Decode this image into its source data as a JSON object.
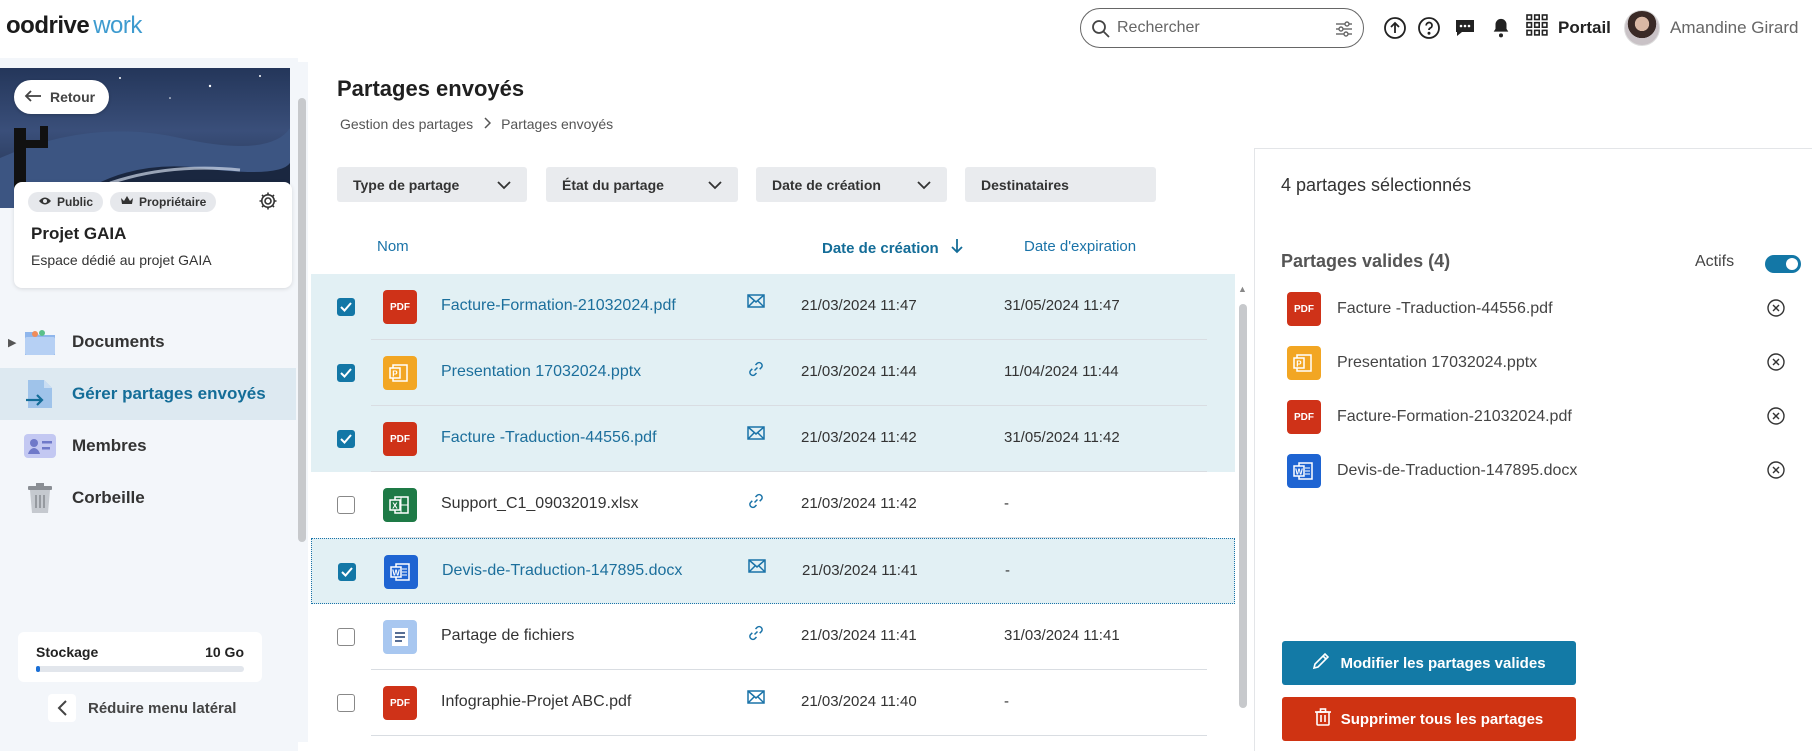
{
  "app": {
    "brand_main": "oodrive",
    "brand_sub": "work"
  },
  "topbar": {
    "search_placeholder": "Rechercher",
    "portail_label": "Portail",
    "user_name": "Amandine Girard"
  },
  "sidebar": {
    "back_label": "Retour",
    "chip_public": "Public",
    "chip_owner": "Propriétaire",
    "project_title": "Projet GAIA",
    "project_desc": "Espace dédié au projet GAIA",
    "items": [
      {
        "label": "Documents",
        "icon": "folder-icon"
      },
      {
        "label": "Gérer partages envoyés",
        "icon": "share-sent-icon",
        "active": true
      },
      {
        "label": "Membres",
        "icon": "members-icon"
      },
      {
        "label": "Corbeille",
        "icon": "trash-icon"
      }
    ],
    "storage_label": "Stockage",
    "storage_value": "10 Go",
    "storage_used_percent": 2,
    "collapse_label": "Réduire menu latéral"
  },
  "main": {
    "title": "Partages envoyés",
    "breadcrumb": [
      "Gestion des partages",
      "Partages envoyés"
    ],
    "filters": [
      "Type de partage",
      "État du partage",
      "Date de création",
      "Destinataires"
    ],
    "columns": {
      "name": "Nom",
      "created": "Date de création",
      "expires": "Date d'expiration"
    },
    "rows": [
      {
        "name": "Facture-Formation-21032024.pdf",
        "ftype": "pdf",
        "share": "mail",
        "created": "21/03/2024 11:47",
        "expires": "31/05/2024 11:47",
        "selected": true
      },
      {
        "name": "Presentation 17032024.pptx",
        "ftype": "ppt",
        "share": "link",
        "created": "21/03/2024 11:44",
        "expires": "11/04/2024 11:44",
        "selected": true
      },
      {
        "name": "Facture -Traduction-44556.pdf",
        "ftype": "pdf",
        "share": "mail",
        "created": "21/03/2024 11:42",
        "expires": "31/05/2024 11:42",
        "selected": true
      },
      {
        "name": "Support_C1_09032019.xlsx",
        "ftype": "xls",
        "share": "link",
        "created": "21/03/2024 11:42",
        "expires": "-",
        "selected": false
      },
      {
        "name": "Devis-de-Traduction-147895.docx",
        "ftype": "doc",
        "share": "mail",
        "created": "21/03/2024 11:41",
        "expires": "-",
        "selected": true
      },
      {
        "name": "Partage de fichiers",
        "ftype": "txt",
        "share": "link",
        "created": "21/03/2024 11:41",
        "expires": "31/03/2024 11:41",
        "selected": false
      },
      {
        "name": "Infographie-Projet ABC.pdf",
        "ftype": "pdf",
        "share": "mail",
        "created": "21/03/2024 11:40",
        "expires": "-",
        "selected": false
      }
    ]
  },
  "panel": {
    "selected_count": "4 partages sélectionnés",
    "valid_title": "Partages valides (4)",
    "toggle_label": "Actifs",
    "valid_items": [
      {
        "name": "Facture -Traduction-44556.pdf",
        "ftype": "pdf"
      },
      {
        "name": "Presentation 17032024.pptx",
        "ftype": "ppt"
      },
      {
        "name": "Facture-Formation-21032024.pdf",
        "ftype": "pdf"
      },
      {
        "name": "Devis-de-Traduction-147895.docx",
        "ftype": "doc"
      }
    ],
    "modify_label": "Modifier les partages valides",
    "delete_label": "Supprimer tous les partages"
  },
  "colors": {
    "accent": "#137aa6",
    "danger": "#cf3312",
    "selected_row": "#e2f0f4"
  }
}
